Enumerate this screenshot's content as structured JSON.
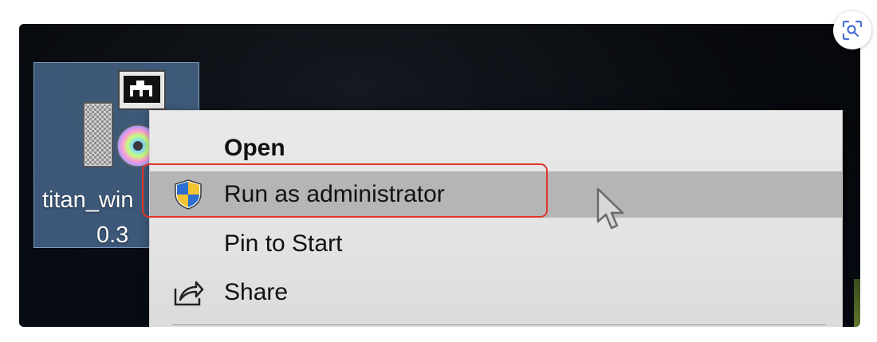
{
  "desktop": {
    "icon": {
      "name_line1": "titan_win",
      "name_line2": "0.3"
    }
  },
  "context_menu": {
    "items": [
      {
        "label": "Open",
        "icon": "none",
        "bold": true
      },
      {
        "label": "Run as administrator",
        "icon": "uac-shield-icon",
        "highlighted": true
      },
      {
        "label": "Pin to Start",
        "icon": "none"
      },
      {
        "label": "Share",
        "icon": "share-icon"
      }
    ]
  },
  "annotation": {
    "highlight_color": "#e0352b",
    "target": "Run as administrator"
  },
  "overlay": {
    "lens_button_icon": "visual-search-icon"
  },
  "colors": {
    "menu_background": "#e6e6e6",
    "hover_row": "#b5b5b5",
    "icon_selection": "#5276a0",
    "shield_blue": "#2c6fd1",
    "shield_yellow": "#f2c230"
  }
}
